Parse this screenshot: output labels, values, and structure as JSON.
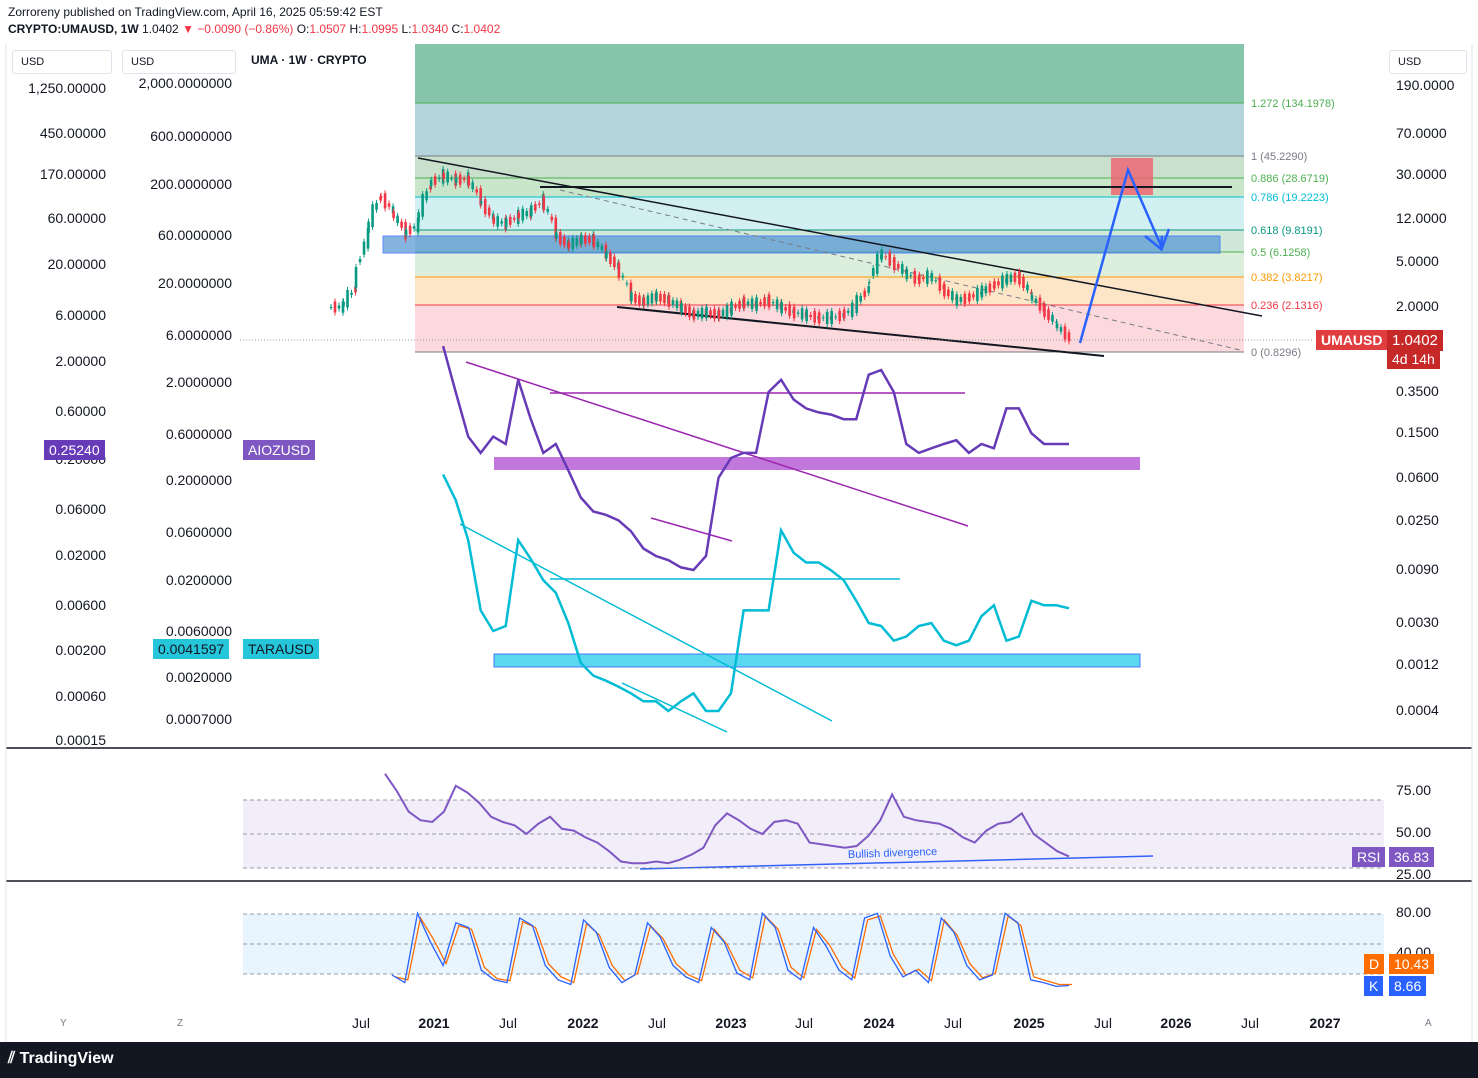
{
  "header": {
    "publisher": "Zorroreny published on TradingView.com, April 16, 2025 05:59:42 EST",
    "symbol": "CRYPTO:UMAUSD, 1W",
    "last": "1.0402",
    "change": "−0.0090 (−0.86%)",
    "open_label": "O:",
    "open": "1.0507",
    "high_label": "H:",
    "high": "1.0995",
    "low_label": "L:",
    "low": "1.0340",
    "close_label": "C:",
    "close": "1.0402"
  },
  "chart_title": "UMA · 1W · CRYPTO",
  "units": {
    "left1": "USD",
    "left2": "USD",
    "right": "USD"
  },
  "left_axis_1": [
    "1,250.00000",
    "450.00000",
    "170.00000",
    "60.00000",
    "20.00000",
    "6.00000",
    "2.00000",
    "0.60000",
    "0.20000",
    "0.06000",
    "0.02000",
    "0.00600",
    "0.00200",
    "0.00060",
    "0.00015"
  ],
  "left_axis_2": [
    "2,000.0000000",
    "600.0000000",
    "200.0000000",
    "60.0000000",
    "20.0000000",
    "6.0000000",
    "2.0000000",
    "0.6000000",
    "0.2000000",
    "0.0600000",
    "0.0200000",
    "0.0060000",
    "0.0020000",
    "0.0007000"
  ],
  "right_axis": [
    "190.0000",
    "70.0000",
    "30.0000",
    "12.0000",
    "5.0000",
    "2.0000",
    "0.3500",
    "0.1500",
    "0.0600",
    "0.0250",
    "0.0090",
    "0.0030",
    "0.0012",
    "0.0004"
  ],
  "badges": {
    "uma_name": "UMAUSD",
    "uma_price": "1.0402",
    "uma_time": "4d 14h",
    "aioz_price": "0.25240",
    "aioz_name": "AIOZUSD",
    "tara_price": "0.0041597",
    "tara_name": "TARAUSD",
    "rsi_name": "RSI",
    "rsi_value": "36.83",
    "d_name": "D",
    "d_value": "10.43",
    "k_name": "K",
    "k_value": "8.66"
  },
  "fib_levels": [
    {
      "label": "1.272 (134.1978)",
      "color": "#4caf50"
    },
    {
      "label": "1 (45.2290)",
      "color": "#787b86"
    },
    {
      "label": "0.886 (28.6719)",
      "color": "#4caf50"
    },
    {
      "label": "0.786 (19.2223)",
      "color": "#00bcd4"
    },
    {
      "label": "0.618 (9.8191)",
      "color": "#089981"
    },
    {
      "label": "0.5 (6.1258)",
      "color": "#4caf50"
    },
    {
      "label": "0.382 (3.8217)",
      "color": "#ff9800"
    },
    {
      "label": "0.236 (2.1316)",
      "color": "#f23645"
    },
    {
      "label": "0 (0.8296)",
      "color": "#787b86"
    }
  ],
  "annotation": "Bullish divergence",
  "rsi_axis": [
    "75.00",
    "50.00",
    "25.00"
  ],
  "stoch_axis": [
    "80.00",
    "40.00"
  ],
  "x_axis": [
    {
      "t": "Jul",
      "year": false
    },
    {
      "t": "2021",
      "year": true
    },
    {
      "t": "Jul",
      "year": false
    },
    {
      "t": "2022",
      "year": true
    },
    {
      "t": "Jul",
      "year": false
    },
    {
      "t": "2023",
      "year": true
    },
    {
      "t": "Jul",
      "year": false
    },
    {
      "t": "2024",
      "year": true
    },
    {
      "t": "Jul",
      "year": false
    },
    {
      "t": "2025",
      "year": true
    },
    {
      "t": "Jul",
      "year": false
    },
    {
      "t": "2026",
      "year": true
    },
    {
      "t": "Jul",
      "year": false
    },
    {
      "t": "2027",
      "year": true
    }
  ],
  "footer": {
    "brand": "TradingView",
    "y": "Y",
    "z": "Z",
    "a": "A"
  },
  "colors": {
    "uma_up": "#089981",
    "uma_down": "#f23645",
    "aioz": "#7e57c2",
    "tara": "#26c6da",
    "rsi": "#7e57c2",
    "stoch_k": "#2962ff",
    "stoch_d": "#ff6d00"
  },
  "chart_data": {
    "type": "line",
    "title": "UMA · 1W · CRYPTO",
    "x": [
      "2020-06",
      "2020-07",
      "2020-08",
      "2020-09",
      "2020-10",
      "2020-11",
      "2020-12",
      "2021-01",
      "2021-02",
      "2021-03",
      "2021-04",
      "2021-05",
      "2021-06",
      "2021-07",
      "2021-08",
      "2021-09",
      "2021-10",
      "2021-11",
      "2021-12",
      "2022-01",
      "2022-02",
      "2022-03",
      "2022-04",
      "2022-05",
      "2022-06",
      "2022-07",
      "2022-08",
      "2022-09",
      "2022-10",
      "2022-11",
      "2022-12",
      "2023-01",
      "2023-02",
      "2023-03",
      "2023-04",
      "2023-05",
      "2023-06",
      "2023-07",
      "2023-08",
      "2023-09",
      "2023-10",
      "2023-11",
      "2023-12",
      "2024-01",
      "2024-02",
      "2024-03",
      "2024-04",
      "2024-05",
      "2024-06",
      "2024-07",
      "2024-08",
      "2024-09",
      "2024-10",
      "2024-11",
      "2024-12",
      "2025-01",
      "2025-02",
      "2025-03",
      "2025-04"
    ],
    "series": [
      {
        "name": "UMAUSD",
        "values": [
          2.0,
          3.0,
          9.0,
          20.0,
          14.0,
          9.0,
          11.0,
          25.0,
          30.0,
          27.0,
          28.0,
          18.0,
          12.0,
          11.0,
          13.0,
          14.0,
          18.0,
          9.0,
          7.0,
          8.0,
          8.0,
          6.0,
          4.5,
          2.5,
          2.2,
          2.5,
          2.3,
          2.0,
          1.7,
          1.8,
          1.7,
          1.9,
          2.2,
          2.1,
          2.3,
          2.0,
          1.8,
          1.7,
          1.6,
          1.6,
          1.7,
          2.0,
          3.0,
          6.0,
          5.0,
          4.0,
          3.5,
          3.8,
          2.9,
          2.3,
          2.4,
          2.7,
          3.1,
          3.5,
          3.8,
          2.5,
          1.9,
          1.4,
          1.04
        ]
      },
      {
        "name": "AIOZUSD",
        "values": [
          null,
          null,
          null,
          null,
          null,
          null,
          null,
          null,
          0.9,
          0.35,
          0.14,
          0.1,
          0.14,
          0.12,
          0.45,
          0.2,
          0.1,
          0.12,
          0.07,
          0.04,
          0.03,
          0.028,
          0.025,
          0.02,
          0.014,
          0.012,
          0.011,
          0.0095,
          0.009,
          0.012,
          0.06,
          0.09,
          0.1,
          0.1,
          0.35,
          0.45,
          0.3,
          0.25,
          0.23,
          0.22,
          0.2,
          0.2,
          0.5,
          0.55,
          0.35,
          0.12,
          0.1,
          0.11,
          0.12,
          0.13,
          0.1,
          0.12,
          0.11,
          0.25,
          0.25,
          0.15,
          0.12,
          0.12,
          0.12
        ]
      },
      {
        "name": "TARAUSD",
        "values": [
          null,
          null,
          null,
          null,
          null,
          null,
          null,
          null,
          0.09,
          0.05,
          0.02,
          0.004,
          0.0025,
          0.0028,
          0.02,
          0.013,
          0.008,
          0.006,
          0.003,
          0.0012,
          0.0009,
          0.0008,
          0.0007,
          0.0006,
          0.0005,
          0.0005,
          0.0004,
          0.0005,
          0.0006,
          0.0004,
          0.0004,
          0.0006,
          0.004,
          0.004,
          0.004,
          0.025,
          0.015,
          0.012,
          0.012,
          0.01,
          0.008,
          0.005,
          0.003,
          0.0028,
          0.002,
          0.0022,
          0.0028,
          0.003,
          0.002,
          0.0018,
          0.002,
          0.0035,
          0.0045,
          0.002,
          0.0022,
          0.005,
          0.0045,
          0.0045,
          0.0042
        ]
      }
    ],
    "rsi": [
      85,
      75,
      63,
      58,
      57,
      63,
      78,
      74,
      68,
      60,
      57,
      55,
      50,
      56,
      60,
      53,
      52,
      48,
      45,
      40,
      34,
      33,
      33,
      34,
      33,
      35,
      38,
      42,
      55,
      62,
      58,
      53,
      50,
      57,
      58,
      56,
      45,
      44,
      43,
      42,
      43,
      49,
      58,
      73,
      60,
      58,
      57,
      56,
      53,
      48,
      45,
      52,
      56,
      57,
      62,
      50,
      45,
      40,
      37
    ],
    "stoch_k": [
      20,
      12,
      85,
      55,
      30,
      75,
      70,
      25,
      15,
      12,
      80,
      72,
      30,
      15,
      10,
      78,
      65,
      28,
      12,
      20,
      75,
      60,
      30,
      18,
      12,
      70,
      55,
      22,
      15,
      85,
      70,
      25,
      15,
      70,
      50,
      25,
      15,
      80,
      85,
      40,
      18,
      25,
      12,
      80,
      65,
      30,
      15,
      20,
      85,
      75,
      15,
      12,
      8,
      9
    ],
    "stoch_d": [
      18,
      15,
      80,
      58,
      32,
      72,
      68,
      28,
      16,
      14,
      76,
      70,
      32,
      18,
      12,
      74,
      62,
      30,
      14,
      22,
      72,
      58,
      32,
      20,
      14,
      68,
      52,
      25,
      17,
      82,
      68,
      28,
      17,
      68,
      52,
      28,
      17,
      78,
      82,
      42,
      20,
      26,
      14,
      78,
      62,
      32,
      17,
      22,
      82,
      72,
      18,
      14,
      10,
      10
    ]
  }
}
